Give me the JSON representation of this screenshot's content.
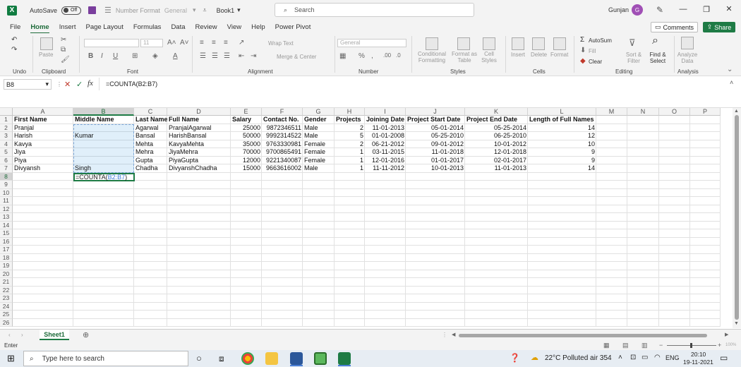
{
  "titlebar": {
    "autosave_label": "AutoSave",
    "autosave_state": "Off",
    "number_format_label": "Number Format",
    "number_format_value": "General",
    "book_title": "Book1",
    "search_placeholder": "Search",
    "user_name": "Gunjan",
    "avatar_initial": "G"
  },
  "menu": {
    "items": [
      "File",
      "Home",
      "Insert",
      "Page Layout",
      "Formulas",
      "Data",
      "Review",
      "View",
      "Help",
      "Power Pivot"
    ],
    "active": "Home",
    "comments_label": "Comments",
    "share_label": "Share"
  },
  "ribbon": {
    "groups": [
      "Undo",
      "Clipboard",
      "Font",
      "Alignment",
      "Number",
      "Styles",
      "Cells",
      "Editing",
      "Analysis"
    ],
    "paste_label": "Paste",
    "font_size": "11",
    "wrap_text": "Wrap Text",
    "merge_center": "Merge & Center",
    "number_format": "General",
    "conditional_formatting": "Conditional Formatting",
    "format_as_table": "Format as Table",
    "cell_styles": "Cell Styles",
    "insert": "Insert",
    "delete": "Delete",
    "format": "Format",
    "autosum": "AutoSum",
    "fill": "Fill",
    "clear": "Clear",
    "sort_filter": "Sort & Filter",
    "find_select": "Find & Select",
    "analyze_data": "Analyze Data"
  },
  "formula_bar": {
    "name_box": "B8",
    "formula": "=COUNTA(B2:B7)"
  },
  "columns": [
    "A",
    "B",
    "C",
    "D",
    "E",
    "F",
    "G",
    "H",
    "I",
    "J",
    "K",
    "L",
    "M",
    "N",
    "O",
    "P"
  ],
  "selected_column": "B",
  "selected_row": "8",
  "row_numbers": [
    "1",
    "2",
    "3",
    "4",
    "5",
    "6",
    "7",
    "8",
    "9",
    "10",
    "11",
    "12",
    "13",
    "14",
    "15",
    "16",
    "17",
    "18",
    "19",
    "20",
    "21",
    "22",
    "23",
    "24",
    "25",
    "26"
  ],
  "table": {
    "headers": [
      "First Name",
      "Middle Name",
      "Last Name",
      "Full Name",
      "Salary",
      "Contact No.",
      "Gender",
      "Projects",
      "Joining Date",
      "Project Start Date",
      "Project End Date",
      "Length of Full Names"
    ],
    "rows": [
      [
        "Pranjal",
        "",
        "Agarwal",
        "PranjalAgarwal",
        "25000",
        "9872346511",
        "Male",
        "2",
        "11-01-2013",
        "05-01-2014",
        "05-25-2014",
        "14"
      ],
      [
        "Harish",
        "Kumar",
        "Bansal",
        "HarishBansal",
        "50000",
        "9992314522",
        "Male",
        "5",
        "01-01-2008",
        "05-25-2010",
        "06-25-2010",
        "12"
      ],
      [
        "Kavya",
        "",
        "Mehta",
        "KavyaMehta",
        "35000",
        "9763330981",
        "Female",
        "2",
        "06-21-2012",
        "09-01-2012",
        "10-01-2012",
        "10"
      ],
      [
        "Jiya",
        "",
        "Mehra",
        "JiyaMehra",
        "70000",
        "9700865491",
        "Female",
        "1",
        "03-11-2015",
        "11-01-2018",
        "12-01-2018",
        "9"
      ],
      [
        "Piya",
        "",
        "Gupta",
        "PiyaGupta",
        "12000",
        "9221340087",
        "Female",
        "1",
        "12-01-2016",
        "01-01-2017",
        "02-01-2017",
        "9"
      ],
      [
        "Divyansh",
        "Singh",
        "Chadha",
        "DivyanshChadha",
        "15000",
        "9663616002",
        "Male",
        "1",
        "11-11-2012",
        "10-01-2013",
        "11-01-2013",
        "14"
      ]
    ]
  },
  "active_cell": {
    "prefix": "=COUNTA(",
    "ref": "B2:B7",
    "suffix": ")"
  },
  "sheets": [
    "Sheet1"
  ],
  "status": {
    "mode": "Enter",
    "zoom": "100%"
  },
  "taskbar": {
    "search_placeholder": "Type here to search",
    "weather": "22°C  Polluted air 354",
    "language": "ENG",
    "time": "20:10",
    "date": "19-11-2021"
  },
  "colors": {
    "excel_green": "#1e7b45",
    "selection_blue": "#3c78d8"
  }
}
